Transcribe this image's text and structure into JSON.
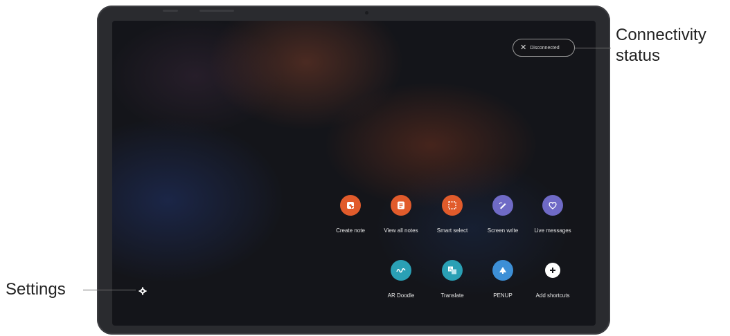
{
  "status": {
    "label": "Disconnected"
  },
  "shortcuts": [
    {
      "label": "Create note",
      "color": "#e15b2b",
      "icon": "create-note-icon"
    },
    {
      "label": "View all notes",
      "color": "#e15b2b",
      "icon": "notes-list-icon"
    },
    {
      "label": "Smart select",
      "color": "#e15b2b",
      "icon": "smart-select-icon"
    },
    {
      "label": "Screen write",
      "color": "#6f6ac6",
      "icon": "screen-write-icon"
    },
    {
      "label": "Live messages",
      "color": "#6f6ac6",
      "icon": "heart-icon"
    },
    {
      "label": "AR Doodle",
      "color": "#2aa0b5",
      "icon": "ar-doodle-icon"
    },
    {
      "label": "Translate",
      "color": "#2aa0b5",
      "icon": "translate-icon"
    },
    {
      "label": "PENUP",
      "color": "#3d8fd6",
      "icon": "penup-icon"
    },
    {
      "label": "Add shortcuts",
      "color": "#ffffff",
      "icon": "plus-icon"
    }
  ],
  "callouts": {
    "connectivity_line1": "Connectivity",
    "connectivity_line2": "status",
    "settings": "Settings"
  }
}
